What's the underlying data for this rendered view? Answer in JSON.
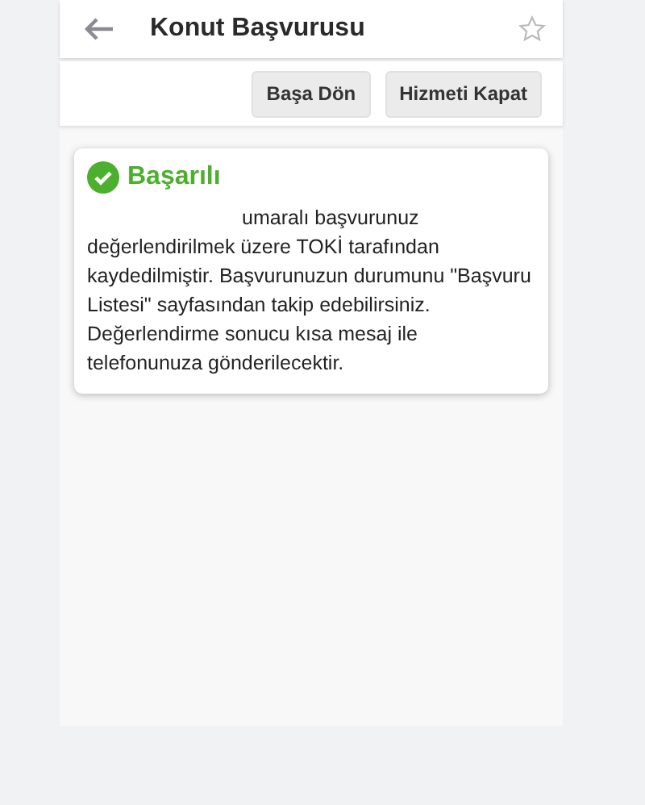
{
  "header": {
    "title": "Konut Başvurusu",
    "favorite": false
  },
  "buttons": [
    {
      "label": "Başa Dön"
    },
    {
      "label": "Hizmeti Kapat"
    }
  ],
  "result": {
    "title": "Başarılı",
    "message": "umaralı başvurunuz değerlendirilmek üzere TOKİ tarafından kaydedilmiştir. Başvurunuzun durumunu \"Başvuru Listesi\" sayfasından takip edebilirsiniz. Değerlendirme sonucu kısa mesaj ile telefonunuza gönderilecektir."
  }
}
